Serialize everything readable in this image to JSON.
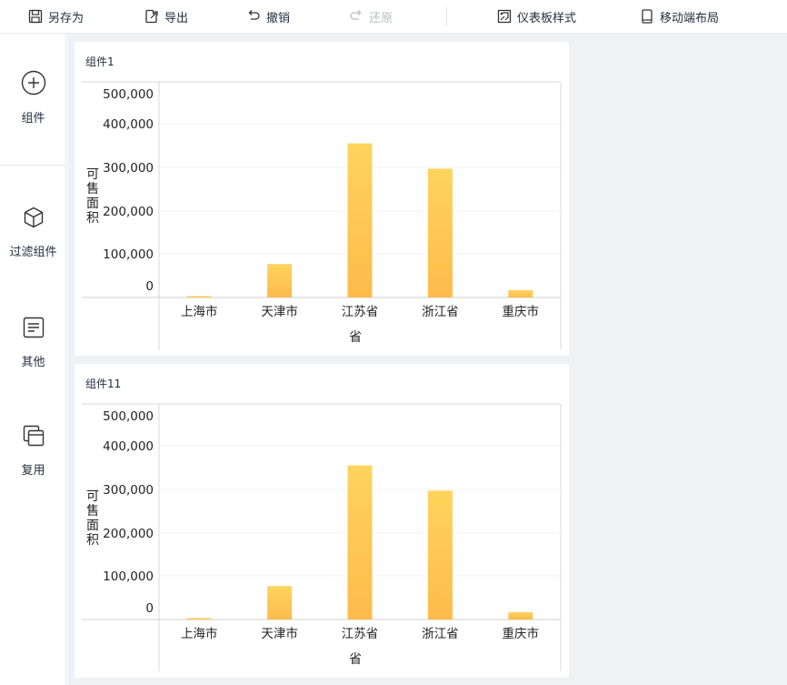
{
  "toolbar": {
    "save_as": "另存为",
    "export": "导出",
    "undo": "撤销",
    "redo": "还原",
    "dashboard_style": "仪表板样式",
    "mobile_layout": "移动端布局"
  },
  "sidebar": {
    "items": [
      {
        "label": "组件",
        "icon": "plus-circle-icon"
      },
      {
        "label": "过滤组件",
        "icon": "cube-icon"
      },
      {
        "label": "其他",
        "icon": "text-box-icon"
      },
      {
        "label": "复用",
        "icon": "copy-windows-icon"
      }
    ]
  },
  "colors": {
    "bar_top": "#ffd45c",
    "bar_bottom": "#fdbb4a",
    "canvas_bg": "#f0f1f5"
  },
  "widgets": [
    {
      "title": "组件1"
    },
    {
      "title": "组件11"
    }
  ],
  "chart_data": [
    {
      "type": "bar",
      "title": "组件1",
      "categories": [
        "上海市",
        "天津市",
        "江苏省",
        "浙江省",
        "重庆市"
      ],
      "values": [
        2000,
        82000,
        378000,
        316000,
        18000
      ],
      "xlabel": "省",
      "ylabel": "可售面积",
      "yticks": [
        "0",
        "100,000",
        "200,000",
        "300,000",
        "400,000",
        "500,000"
      ],
      "ylim": [
        0,
        500000
      ],
      "grid": true,
      "legend": "none"
    },
    {
      "type": "bar",
      "title": "组件11",
      "categories": [
        "上海市",
        "天津市",
        "江苏省",
        "浙江省",
        "重庆市"
      ],
      "values": [
        2000,
        82000,
        378000,
        316000,
        18000
      ],
      "xlabel": "省",
      "ylabel": "可售面积",
      "yticks": [
        "0",
        "100,000",
        "200,000",
        "300,000",
        "400,000",
        "500,000"
      ],
      "ylim": [
        0,
        500000
      ],
      "grid": true,
      "legend": "none"
    }
  ]
}
